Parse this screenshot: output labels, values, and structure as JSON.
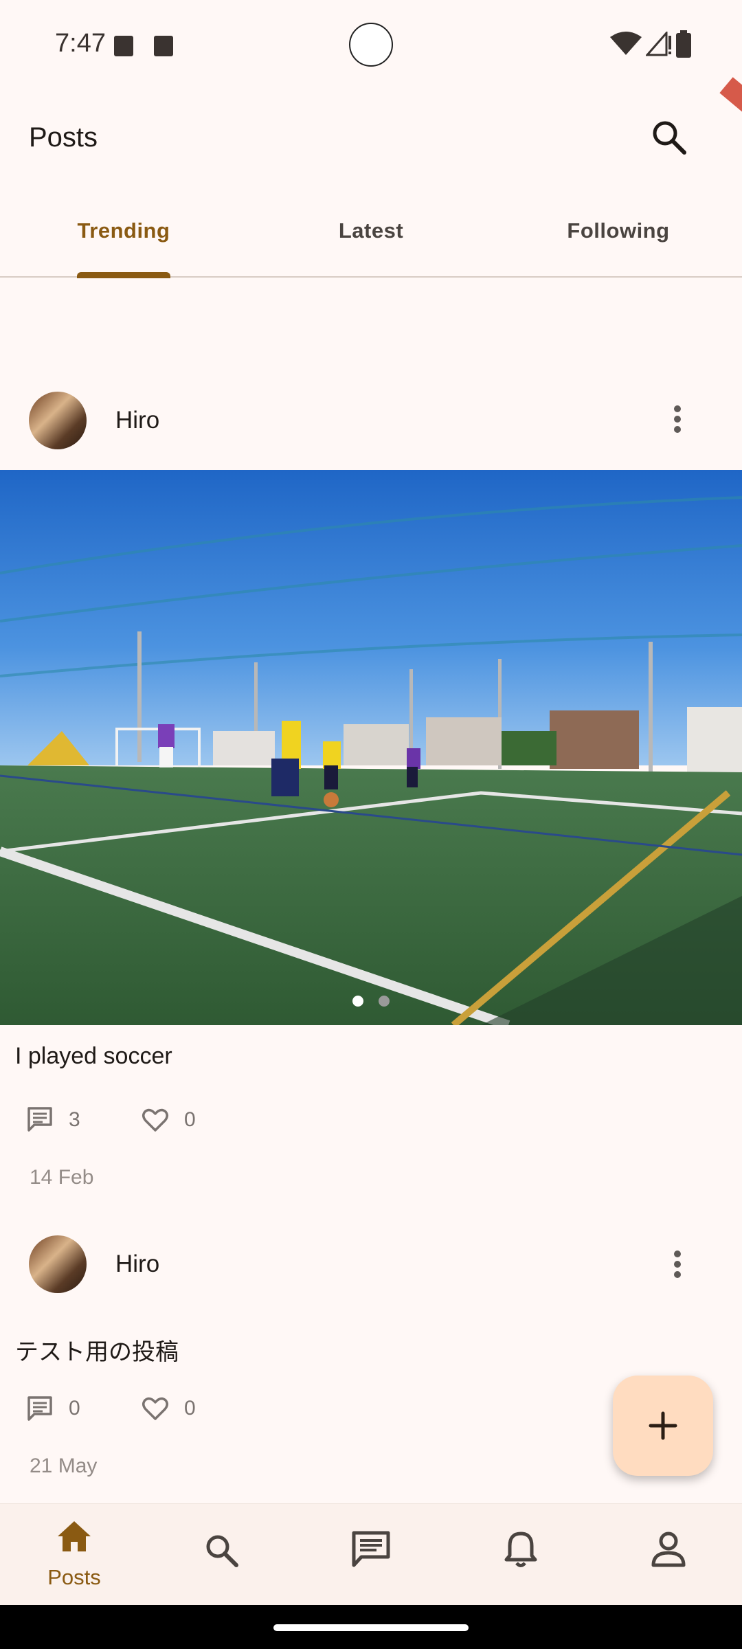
{
  "status_bar": {
    "time": "7:47"
  },
  "app_bar": {
    "title": "Posts"
  },
  "tabs": [
    {
      "label": "Trending",
      "active": true
    },
    {
      "label": "Latest",
      "active": false
    },
    {
      "label": "Following",
      "active": false
    }
  ],
  "posts": [
    {
      "author": "Hiro",
      "caption": "I played soccer",
      "comments": "3",
      "likes": "0",
      "date": "14 Feb",
      "carousel_pages": 2,
      "carousel_current": 1
    },
    {
      "author": "Hiro",
      "caption": "テスト用の投稿",
      "comments": "0",
      "likes": "0",
      "date": "21 May"
    }
  ],
  "bottom_nav": {
    "items": [
      {
        "icon": "home-icon",
        "label": "Posts",
        "active": true
      },
      {
        "icon": "search-icon",
        "active": false
      },
      {
        "icon": "chat-icon",
        "active": false
      },
      {
        "icon": "bell-icon",
        "active": false
      },
      {
        "icon": "person-icon",
        "active": false
      }
    ]
  },
  "colors": {
    "accent": "#8a5a12",
    "background": "#fff8f6",
    "fab": "#ffdcc0"
  }
}
